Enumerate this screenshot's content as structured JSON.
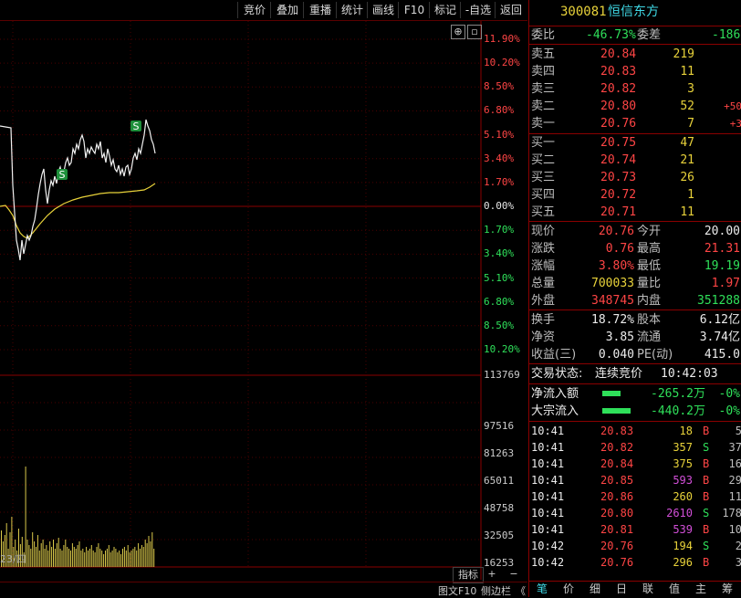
{
  "toolbar": {
    "buttons": [
      "竞价",
      "叠加",
      "重播",
      "统计",
      "画线",
      "F10",
      "标记",
      "-自选",
      "返回"
    ]
  },
  "chart": {
    "price_labels": [
      {
        "text": "11.90%",
        "color": "#ff4545"
      },
      {
        "text": "10.20%",
        "color": "#ff4545"
      },
      {
        "text": "8.50%",
        "color": "#ff4545"
      },
      {
        "text": "6.80%",
        "color": "#ff4545"
      },
      {
        "text": "5.10%",
        "color": "#ff4545"
      },
      {
        "text": "3.40%",
        "color": "#ff4545"
      },
      {
        "text": "1.70%",
        "color": "#ff4545"
      },
      {
        "text": "0.00%",
        "color": "#e6e6e6"
      },
      {
        "text": "1.70%",
        "color": "#2fe05a"
      },
      {
        "text": "3.40%",
        "color": "#2fe05a"
      },
      {
        "text": "5.10%",
        "color": "#2fe05a"
      },
      {
        "text": "6.80%",
        "color": "#2fe05a"
      },
      {
        "text": "8.50%",
        "color": "#2fe05a"
      },
      {
        "text": "10.20%",
        "color": "#2fe05a"
      }
    ],
    "volume_labels": [
      "113769",
      "97516",
      "81263",
      "65011",
      "48758",
      "32505",
      "16253"
    ],
    "date_label": "23/四",
    "marker_s": "S",
    "settings_glyph": "⊕",
    "close_glyph": "▫"
  },
  "bottom_left": {
    "indicator_label": "指标",
    "plus_label": "+",
    "minus_label": "−",
    "f10_label": "图文F10",
    "sidebar_label": "侧边栏",
    "arrows_label": "《"
  },
  "quote": {
    "code": "300081",
    "name": "恒信东方",
    "webi_label": "委比",
    "webi_value": "-46.73%",
    "weicha_label": "委差",
    "weicha_value": "-186",
    "asks": [
      {
        "label": "卖五",
        "price": "20.84",
        "vol": "219",
        "delta": ""
      },
      {
        "label": "卖四",
        "price": "20.83",
        "vol": "11",
        "delta": ""
      },
      {
        "label": "卖三",
        "price": "20.82",
        "vol": "3",
        "delta": ""
      },
      {
        "label": "卖二",
        "price": "20.80",
        "vol": "52",
        "delta": "+50"
      },
      {
        "label": "卖一",
        "price": "20.76",
        "vol": "7",
        "delta": "+3"
      }
    ],
    "bids": [
      {
        "label": "买一",
        "price": "20.75",
        "vol": "47"
      },
      {
        "label": "买二",
        "price": "20.74",
        "vol": "21"
      },
      {
        "label": "买三",
        "price": "20.73",
        "vol": "26"
      },
      {
        "label": "买四",
        "price": "20.72",
        "vol": "1"
      },
      {
        "label": "买五",
        "price": "20.71",
        "vol": "11"
      }
    ],
    "stats": [
      {
        "l1": "现价",
        "v1": "20.76",
        "c1": "red",
        "l2": "今开",
        "v2": "20.00",
        "c2": "white"
      },
      {
        "l1": "涨跌",
        "v1": "0.76",
        "c1": "red",
        "l2": "最高",
        "v2": "21.31",
        "c2": "red"
      },
      {
        "l1": "涨幅",
        "v1": "3.80%",
        "c1": "red",
        "l2": "最低",
        "v2": "19.19",
        "c2": "green"
      },
      {
        "l1": "总量",
        "v1": "700033",
        "c1": "yellow",
        "l2": "量比",
        "v2": "1.97",
        "c2": "red"
      },
      {
        "l1": "外盘",
        "v1": "348745",
        "c1": "red",
        "l2": "内盘",
        "v2": "351288",
        "c2": "green"
      }
    ],
    "fundamentals": [
      {
        "l1": "换手",
        "v1": "18.72%",
        "l2": "股本",
        "v2": "6.12亿"
      },
      {
        "l1": "净资",
        "v1": "3.85",
        "l2": "流通",
        "v2": "3.74亿"
      },
      {
        "l1": "收益(三)",
        "v1": "0.040",
        "l2": "PE(动)",
        "v2": "415.0"
      }
    ],
    "status_label": "交易状态:",
    "status_value": "连续竞价",
    "status_time": "10:42:03",
    "flows": [
      {
        "label": "净流入额",
        "value": "-265.2万",
        "pct": "-0%",
        "bar": 0.35
      },
      {
        "label": "大宗流入",
        "value": "-440.2万",
        "pct": "-0%",
        "bar": 0.55
      }
    ],
    "ticks": [
      {
        "time": "10:41",
        "price": "20.83",
        "vol": "18",
        "vol_color": "yellow",
        "side": "B",
        "count": "5"
      },
      {
        "time": "10:41",
        "price": "20.82",
        "vol": "357",
        "vol_color": "yellow",
        "side": "S",
        "count": "37"
      },
      {
        "time": "10:41",
        "price": "20.84",
        "vol": "375",
        "vol_color": "yellow",
        "side": "B",
        "count": "16"
      },
      {
        "time": "10:41",
        "price": "20.85",
        "vol": "593",
        "vol_color": "magenta",
        "side": "B",
        "count": "29"
      },
      {
        "time": "10:41",
        "price": "20.86",
        "vol": "260",
        "vol_color": "yellow",
        "side": "B",
        "count": "11"
      },
      {
        "time": "10:41",
        "price": "20.80",
        "vol": "2610",
        "vol_color": "magenta",
        "side": "S",
        "count": "178"
      },
      {
        "time": "10:41",
        "price": "20.81",
        "vol": "539",
        "vol_color": "magenta",
        "side": "B",
        "count": "10"
      },
      {
        "time": "10:42",
        "price": "20.76",
        "vol": "194",
        "vol_color": "yellow",
        "side": "S",
        "count": "2"
      },
      {
        "time": "10:42",
        "price": "20.76",
        "vol": "296",
        "vol_color": "yellow",
        "side": "B",
        "count": "3"
      }
    ],
    "bottom_tabs": [
      "笔",
      "价",
      "细",
      "日",
      "联",
      "值",
      "主",
      "筹"
    ]
  }
}
